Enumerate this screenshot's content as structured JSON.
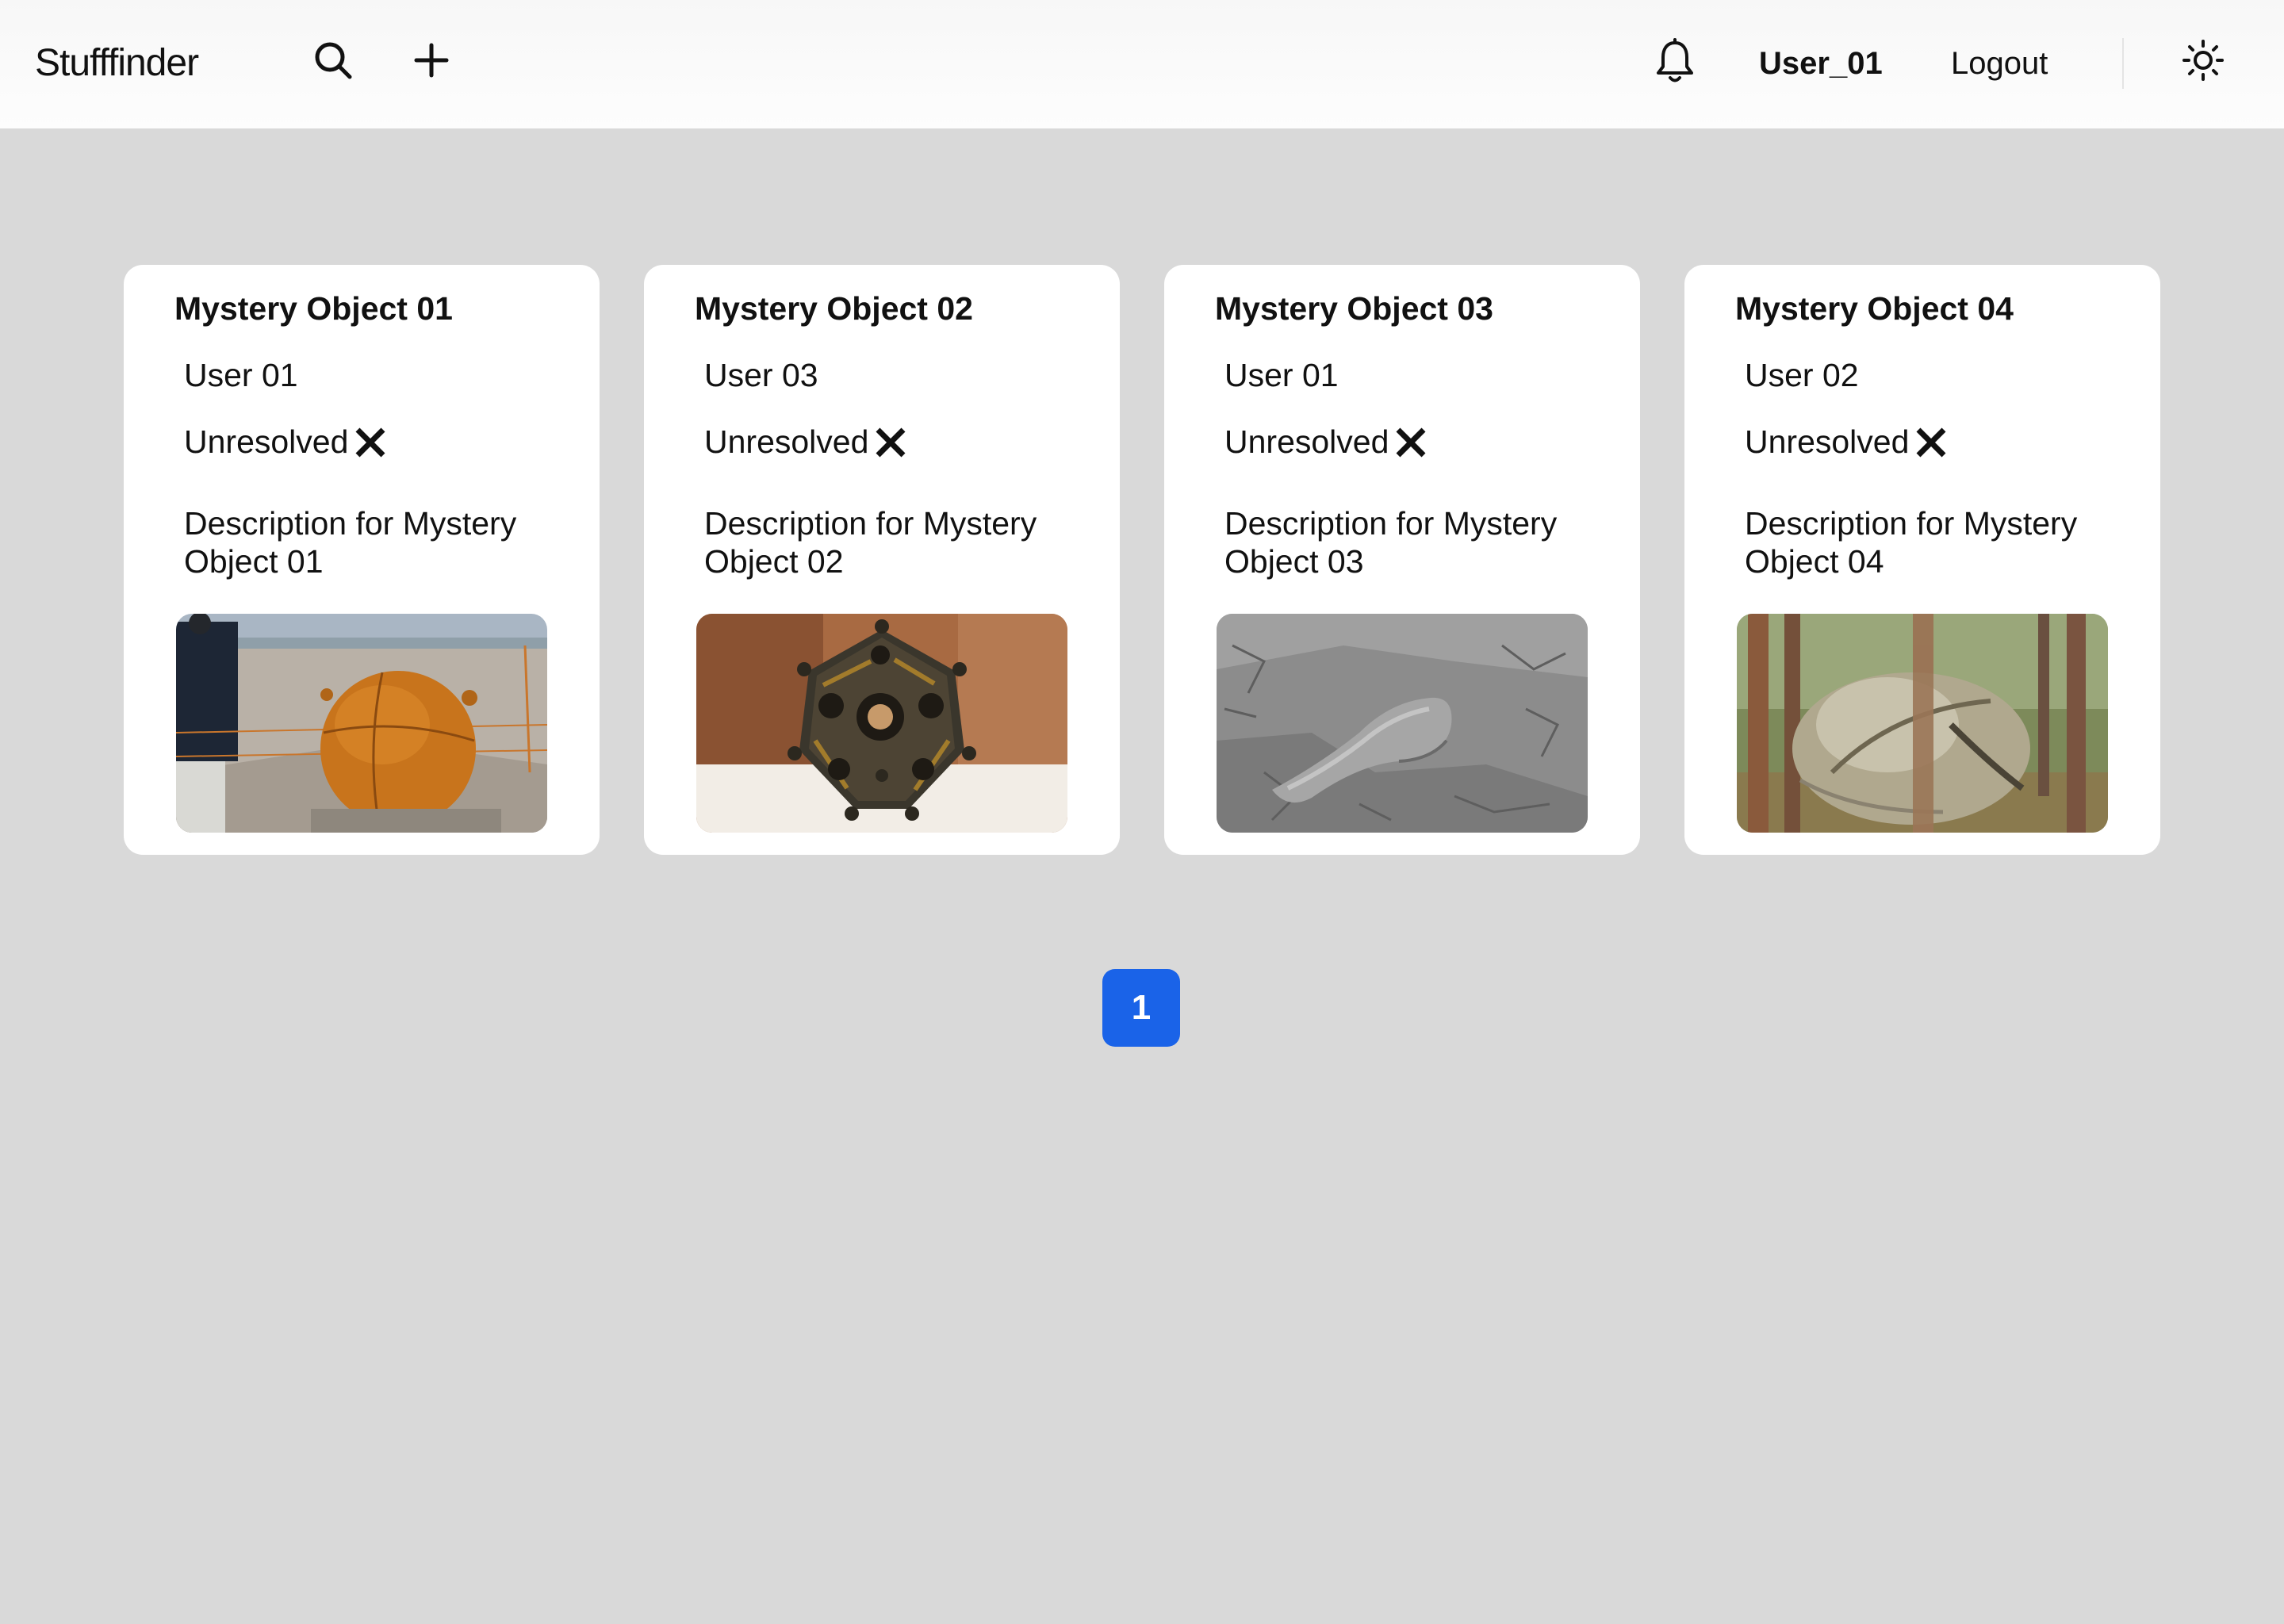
{
  "header": {
    "brand": "Stufffinder",
    "user_name": "User_01",
    "logout_label": "Logout",
    "icons": [
      "search-icon",
      "plus-icon",
      "bell-icon",
      "sun-icon"
    ]
  },
  "cards": [
    {
      "title": "Mystery Object 01",
      "user": "User 01",
      "status": "Unresolved",
      "status_icon": "x-icon",
      "description": "Description for Mystery Object 01",
      "image": "rusty-orange-sphere-on-beach-photo"
    },
    {
      "title": "Mystery Object 02",
      "user": "User 03",
      "status": "Unresolved",
      "status_icon": "x-icon",
      "description": "Description for Mystery Object 02",
      "image": "bronze-dodecahedron-photo"
    },
    {
      "title": "Mystery Object 03",
      "user": "User 01",
      "status": "Unresolved",
      "status_icon": "x-icon",
      "description": "Description for Mystery Object 03",
      "image": "grayscale-object-on-cracked-ground-photo"
    },
    {
      "title": "Mystery Object 04",
      "user": "User 02",
      "status": "Unresolved",
      "status_icon": "x-icon",
      "description": "Description for Mystery Object 04",
      "image": "metal-sphere-in-forest-photo"
    }
  ],
  "pagination": {
    "current_page": "1"
  },
  "colors": {
    "background": "#d9d9d9",
    "card": "#ffffff",
    "accent": "#1a63e8"
  }
}
